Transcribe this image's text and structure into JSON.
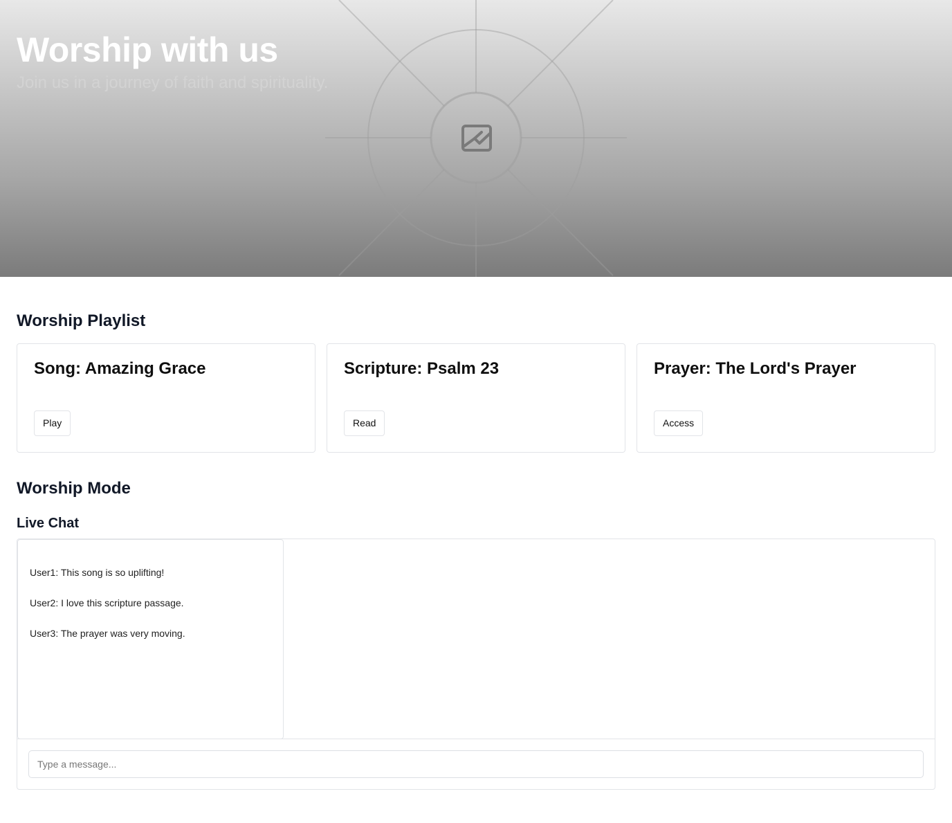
{
  "hero": {
    "title": "Worship with us",
    "subtitle": "Join us in a journey of faith and spirituality.",
    "image_icon": "image-placeholder-icon"
  },
  "playlist": {
    "heading": "Worship Playlist",
    "items": [
      {
        "title": "Song: Amazing Grace",
        "action": "Play"
      },
      {
        "title": "Scripture: Psalm 23",
        "action": "Read"
      },
      {
        "title": "Prayer: The Lord's Prayer",
        "action": "Access"
      }
    ]
  },
  "worship_mode": {
    "heading": "Worship Mode"
  },
  "chat": {
    "heading": "Live Chat",
    "messages": [
      "User1: This song is so uplifting!",
      "User2: I love this scripture passage.",
      "User3: The prayer was very moving."
    ],
    "input_placeholder": "Type a message...",
    "input_value": ""
  },
  "colors": {
    "text_dark": "#111827",
    "border": "#e2e4e8",
    "hero_top": "#e8e8e8",
    "hero_bottom": "#7b7b7b"
  }
}
